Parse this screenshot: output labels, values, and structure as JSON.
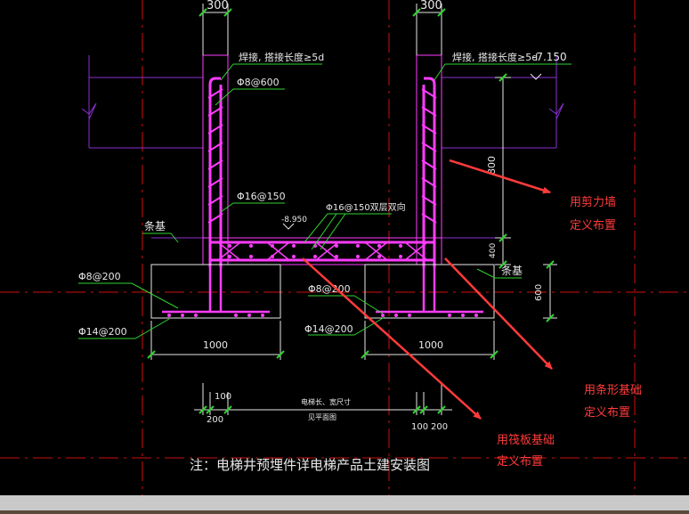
{
  "colors": {
    "background": "#000000",
    "structure": "#ff3cff",
    "dimension": "#e8e8e8",
    "leader": "#2fd32f",
    "centerline": "#d01010",
    "level": "#8b2fd0",
    "annotation_arrow": "#ff3b3b",
    "annotation_text": "#ff3b3b",
    "bottom_bar": "#c9c9c9"
  },
  "dimensions": {
    "wall_thickness_left": "300",
    "wall_thickness_right": "300",
    "pit_height": "800",
    "slab_thickness": "400",
    "strip_height": "600",
    "strip_width_left": "1000",
    "strip_width_right": "1000",
    "offset_100_left": "100",
    "offset_200_left": "200",
    "offset_100_right": "100",
    "offset_200_right": "200",
    "pit_size_label": "电梯长、宽尺寸",
    "pit_size_sub": "见平面图"
  },
  "labels": {
    "weld_note_left": "焊接, 搭接长度≥5d",
    "weld_note_right": "焊接, 搭接长度≥5d",
    "top_level": "-7.150",
    "bottom_level": "-8.950",
    "wall_rebar_vertical": "Φ8@600",
    "wall_rebar_horizontal": "Φ16@150",
    "slab_rebar": "Φ16@150双层双向",
    "strip_label_left": "条基",
    "strip_label_right": "条基",
    "strip_stirrup_left": "Φ8@200",
    "strip_stirrup_right": "Φ8@200",
    "strip_main_left": "Φ14@200",
    "strip_main_right": "Φ14@200"
  },
  "note": "注：电梯井预埋件详电梯产品土建安装图",
  "annotations": [
    {
      "line1": "用剪力墙",
      "line2": "定义布置"
    },
    {
      "line1": "用条形基础",
      "line2": "定义布置"
    },
    {
      "line1": "用筏板基础",
      "line2": "定义布置"
    }
  ]
}
